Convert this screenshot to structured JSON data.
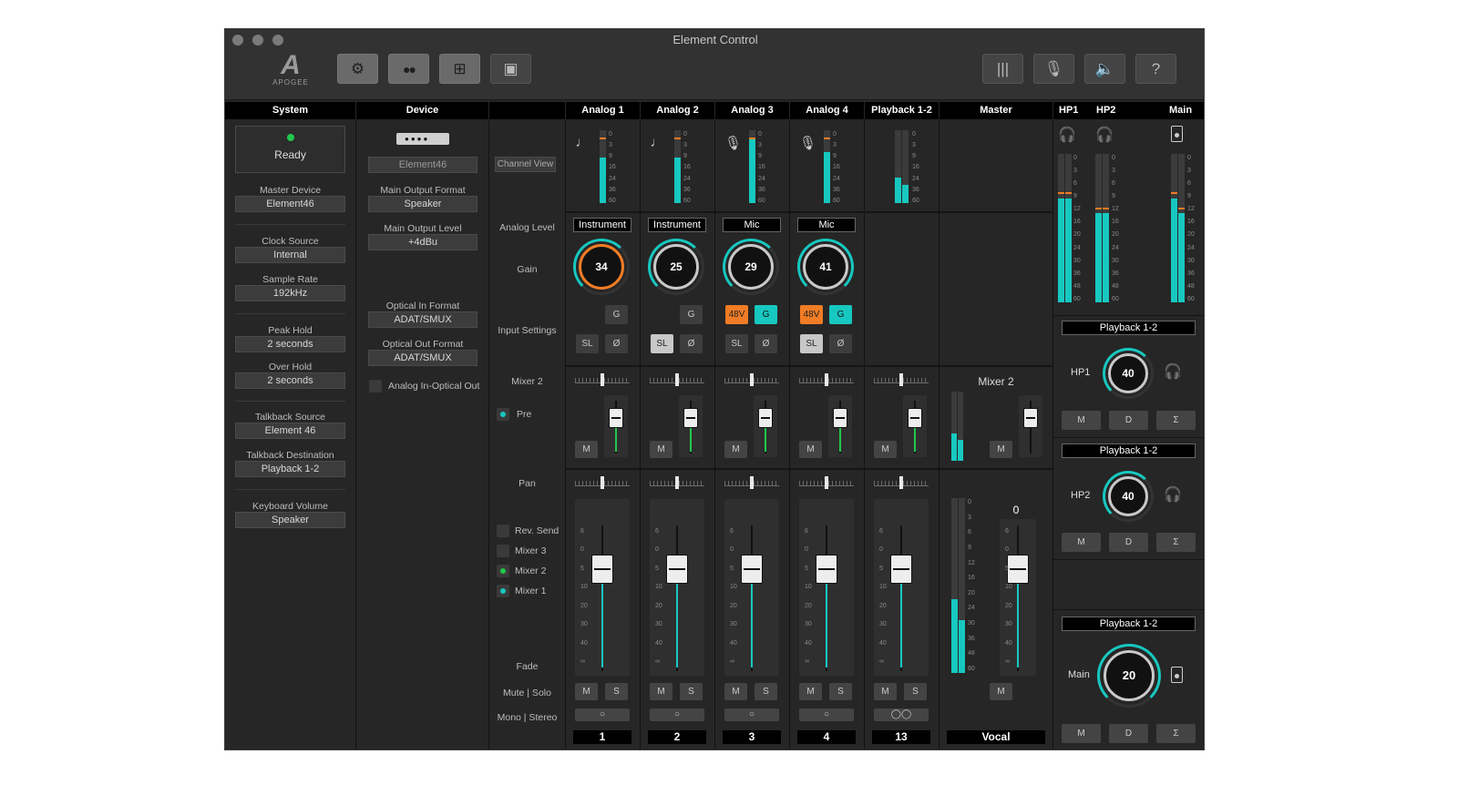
{
  "window": {
    "title": "Element Control",
    "logo_text": "APOGEE"
  },
  "headers": {
    "system": "System",
    "device": "Device",
    "analog1": "Analog 1",
    "analog2": "Analog 2",
    "analog3": "Analog 3",
    "analog4": "Analog 4",
    "playback": "Playback 1-2",
    "master": "Master",
    "hp1": "HP1",
    "hp2": "HP2",
    "main": "Main"
  },
  "system": {
    "status": "Ready",
    "master_device_label": "Master Device",
    "master_device": "Element46",
    "clock_label": "Clock Source",
    "clock": "Internal",
    "rate_label": "Sample Rate",
    "rate": "192kHz",
    "peak_label": "Peak Hold",
    "peak": "2 seconds",
    "over_label": "Over Hold",
    "over": "2 seconds",
    "tb_src_label": "Talkback Source",
    "tb_src": "Element 46",
    "tb_dst_label": "Talkback Destination",
    "tb_dst": "Playback 1-2",
    "kv_label": "Keyboard Volume",
    "kv": "Speaker"
  },
  "device": {
    "name": "Element46",
    "mof_label": "Main Output Format",
    "mof": "Speaker",
    "mol_label": "Main Output Level",
    "mol": "+4dBu",
    "oif_label": "Optical In Format",
    "oif": "ADAT/SMUX",
    "oof_label": "Optical Out Format",
    "oof": "ADAT/SMUX",
    "aio_label": "Analog In-Optical Out"
  },
  "rowlabels": {
    "channel_view": "Channel View",
    "analog_level": "Analog Level",
    "gain": "Gain",
    "input_settings": "Input Settings",
    "mixer2": "Mixer 2",
    "pre": "Pre",
    "pan": "Pan",
    "rev_send": "Rev. Send",
    "mixer3": "Mixer 3",
    "mixer2b": "Mixer 2",
    "mixer1": "Mixer 1",
    "fade": "Fade",
    "mute_solo": "Mute | Solo",
    "mono_stereo": "Mono | Stereo"
  },
  "channels": [
    {
      "type": "Instrument",
      "gain": "34",
      "fader": "0",
      "num": "1"
    },
    {
      "type": "Instrument",
      "gain": "25",
      "fader": "0",
      "num": "2"
    },
    {
      "type": "Mic",
      "gain": "29",
      "fader": "0",
      "num": "3"
    },
    {
      "type": "Mic",
      "gain": "41",
      "fader": "0",
      "num": "4"
    },
    {
      "type": "",
      "gain": "",
      "fader": "0",
      "num": "13"
    },
    {
      "type": "",
      "gain": "",
      "fader": "0",
      "num": "Vocal"
    }
  ],
  "buttons": {
    "g": "G",
    "sl": "SL",
    "phase": "Ø",
    "p48": "48V",
    "m": "M",
    "s": "S",
    "d": "D",
    "sum": "Σ",
    "mono": "○",
    "stereo": "◯◯"
  },
  "master_mixer": "Mixer 2",
  "outputs": {
    "hp1_src": "Playback 1-2",
    "hp1_label": "HP1",
    "hp1_vol": "40",
    "hp2_src": "Playback 1-2",
    "hp2_label": "HP2",
    "hp2_vol": "40",
    "main_src": "Playback 1-2",
    "main_label": "Main",
    "main_vol": "20"
  },
  "meter_scale": [
    "0",
    "3",
    "9",
    "16",
    "24",
    "36",
    "60"
  ],
  "meter_scale_long": [
    "0",
    "3",
    "6",
    "9",
    "12",
    "16",
    "20",
    "24",
    "30",
    "36",
    "48",
    "60"
  ],
  "fader_scale": [
    "6",
    "0",
    "5",
    "10",
    "20",
    "30",
    "40",
    "∞"
  ],
  "mix_scale": [
    "6",
    "0",
    "∞"
  ],
  "levels": {
    "a1": 0.62,
    "a2": 0.62,
    "a3": 0.88,
    "a4": 0.7,
    "pb1": 0.35,
    "pb2": 0.25,
    "hp_l": 0.7,
    "hp_r": 0.6,
    "master_l": 0.42
  }
}
